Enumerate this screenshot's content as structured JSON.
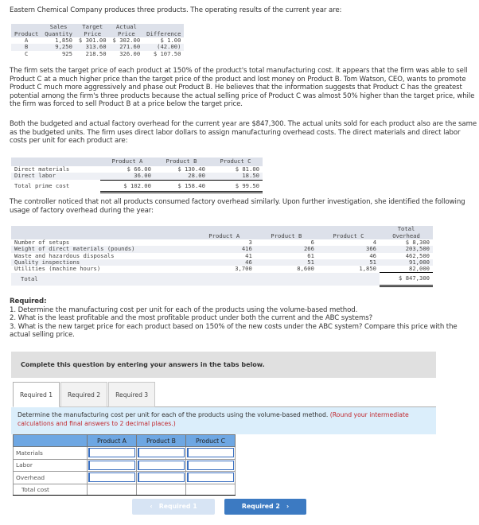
{
  "intro": "Eastern Chemical Company produces three products. The operating results of the current year are:",
  "results_table": {
    "headers": [
      [
        "",
        "Product"
      ],
      [
        "Sales",
        "Quantity"
      ],
      [
        "Target",
        "Price"
      ],
      [
        "Actual",
        "Price"
      ],
      [
        "",
        "Difference"
      ]
    ],
    "rows": [
      [
        "A",
        "1,850",
        "$ 301.00",
        "$ 302.00",
        "$ 1.00"
      ],
      [
        "B",
        "9,250",
        "313.60",
        "271.60",
        "(42.00)"
      ],
      [
        "C",
        "925",
        "218.50",
        "326.00",
        "$ 107.50"
      ]
    ]
  },
  "para1": "The firm sets the target price of each product at 150% of the product's total manufacturing cost. It appears that the firm was able to sell Product C at a much higher price than the target price of the product and lost money on Product B. Tom Watson, CEO, wants to promote Product C much more aggressively and phase out Product B. He believes that the information suggests that Product C has the greatest potential among the firm's three products because the actual selling price of Product C was almost 50% higher than the target price, while the firm was forced to sell Product B at a price below the target price.",
  "para2": "Both the budgeted and actual factory overhead for the current year are $847,300. The actual units sold for each product also are the same as the budgeted units. The firm uses direct labor dollars to assign manufacturing overhead costs. The direct materials and direct labor costs per unit for each product are:",
  "prime_table": {
    "headers": [
      "",
      "Product A",
      "Product B",
      "Product C"
    ],
    "rows": [
      [
        "Direct materials",
        "$ 66.00",
        "$ 130.40",
        "$ 81.00"
      ],
      [
        "Direct labor",
        "36.00",
        "28.00",
        "18.50"
      ]
    ],
    "total": [
      "Total prime cost",
      "$ 102.00",
      "$ 158.40",
      "$ 99.50"
    ]
  },
  "para3": "The controller noticed that not all products consumed factory overhead similarly. Upon further investigation, she identified the following usage of factory overhead during the year:",
  "overhead_table": {
    "headers": [
      "",
      "Product A",
      "Product B",
      "Product C",
      "Total",
      "Overhead"
    ],
    "rows": [
      [
        "Number of setups",
        "3",
        "6",
        "4",
        "$ 8,300"
      ],
      [
        "Weight of direct materials (pounds)",
        "416",
        "266",
        "366",
        "203,500"
      ],
      [
        "Waste and hazardous disposals",
        "41",
        "61",
        "46",
        "462,500"
      ],
      [
        "Quality inspections",
        "46",
        "51",
        "51",
        "91,000"
      ],
      [
        "Utilities (machine hours)",
        "3,700",
        "8,600",
        "1,850",
        "82,000"
      ]
    ],
    "total_label": "Total",
    "total_value": "$ 847,300"
  },
  "required": {
    "title": "Required:",
    "items": [
      "1. Determine the manufacturing cost per unit for each of the products using the volume-based method.",
      "2. What is the least profitable and the most profitable product under both the current and the ABC systems?",
      "3. What is the new target price for each product based on 150% of the new costs under the ABC system? Compare this price with the actual selling price."
    ]
  },
  "complete_banner": "Complete this question by entering your answers in the tabs below.",
  "tabs": [
    {
      "label": "Required 1",
      "active": true
    },
    {
      "label": "Required 2",
      "active": false
    },
    {
      "label": "Required 3",
      "active": false
    }
  ],
  "instruction": {
    "text": "Determine the manufacturing cost per unit for each of the products using the volume-based method.",
    "note": "(Round your intermediate calculations and final answers to 2 decimal places.)"
  },
  "answer_table": {
    "headers": [
      "",
      "Product A",
      "Product B",
      "Product C"
    ],
    "rows": [
      {
        "label": "Materials",
        "values": [
          "",
          "",
          ""
        ]
      },
      {
        "label": "Labor",
        "values": [
          "",
          "",
          ""
        ]
      },
      {
        "label": "Overhead",
        "values": [
          "",
          "",
          ""
        ]
      }
    ],
    "total_label": "Total cost"
  },
  "nav": {
    "prev_label": "Required 1",
    "next_label": "Required 2",
    "prev_icon": "chevron-left-icon",
    "next_icon": "chevron-right-icon"
  },
  "colors": {
    "header_gray": "#dde1ea",
    "answer_header_blue": "#6ea7e3",
    "instruction_bg": "#dbeefb",
    "note_red": "#c1272d",
    "next_button": "#3c7ac2",
    "prev_button_disabled": "#d7e4f4"
  }
}
